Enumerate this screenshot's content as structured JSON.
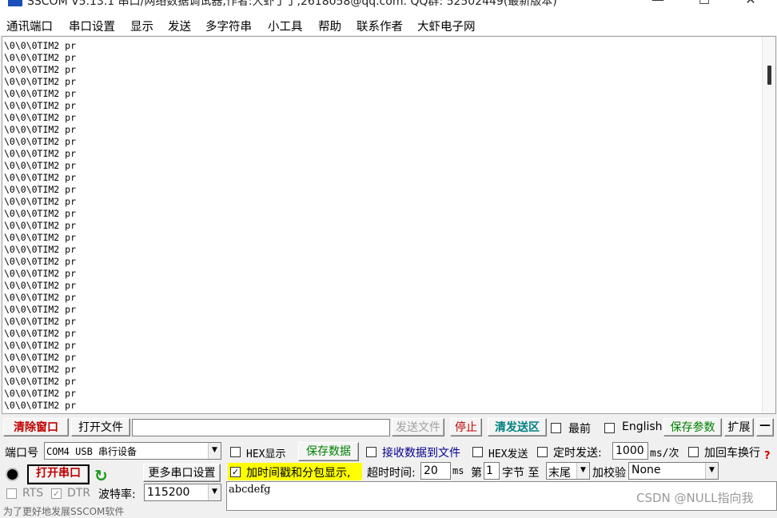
{
  "window": {
    "title": "SSCOM V5.13.1 串口/网络数据调试器,作者:大虾丁丁,2618058@qq.com. QQ群: 52502449(最新版本)",
    "minimize_glyph": "—",
    "maximize_glyph": "☐",
    "close_glyph": "✕"
  },
  "menu": [
    "通讯端口",
    "串口设置",
    "显示",
    "发送",
    "多字符串",
    "小工具",
    "帮助",
    "联系作者",
    "大虾电子网"
  ],
  "receive": {
    "line_text": "\\0\\0\\0TIM2 pr",
    "line_count": 31
  },
  "toolbar": {
    "clear_window": "清除窗口",
    "open_file": "打开文件",
    "file_path": "",
    "send_file": "发送文件",
    "stop": "停止",
    "clear_send": "清发送区",
    "front_label": "最前",
    "english_label": "English",
    "save_params": "保存参数",
    "expand": "扩展",
    "collapse": "—"
  },
  "port": {
    "port_label": "端口号",
    "port_value": "COM4 USB 串行设备",
    "open_port": "打开串口",
    "more_settings": "更多串口设置",
    "rts_label": "RTS",
    "dtr_label": "DTR",
    "baud_label": "波特率:",
    "baud_value": "115200",
    "bottom_hint": "为了更好地发展SSCOM软件"
  },
  "options": {
    "hex_display": "HEX显示",
    "save_data": "保存数据",
    "recv_to_file": "接收数据到文件",
    "hex_send": "HEX发送",
    "timed_send": "定时发送:",
    "interval_value": "1000",
    "interval_unit": "ms/次",
    "add_crlf": "加回车换行",
    "timestamp_label": "加时间戳和分包显示,",
    "timeout_label": "超时时间:",
    "timeout_value": "20",
    "timeout_unit": "ms",
    "nth_label": "第",
    "nth_value": "1",
    "byte_label": "字节 至",
    "end_value": "末尾",
    "checksum_label": "加校验",
    "checksum_value": "None",
    "help_glyph": "?"
  },
  "send": {
    "text": "abcdefg"
  },
  "watermark": "CSDN @NULL指向我",
  "colors": {
    "title_icon": "#1b4fb8",
    "timestamp_highlight": "#ffff00",
    "clear_send_text": "#008080",
    "save_params_text": "#008000",
    "save_data_text": "#008000",
    "recv_to_file_text": "#00008b",
    "clear_window_text": "#c00000",
    "stop_text": "#c00000",
    "open_port_text": "#c00000",
    "refresh_icon": "#1a9a1a",
    "record_icon": "#000000"
  }
}
